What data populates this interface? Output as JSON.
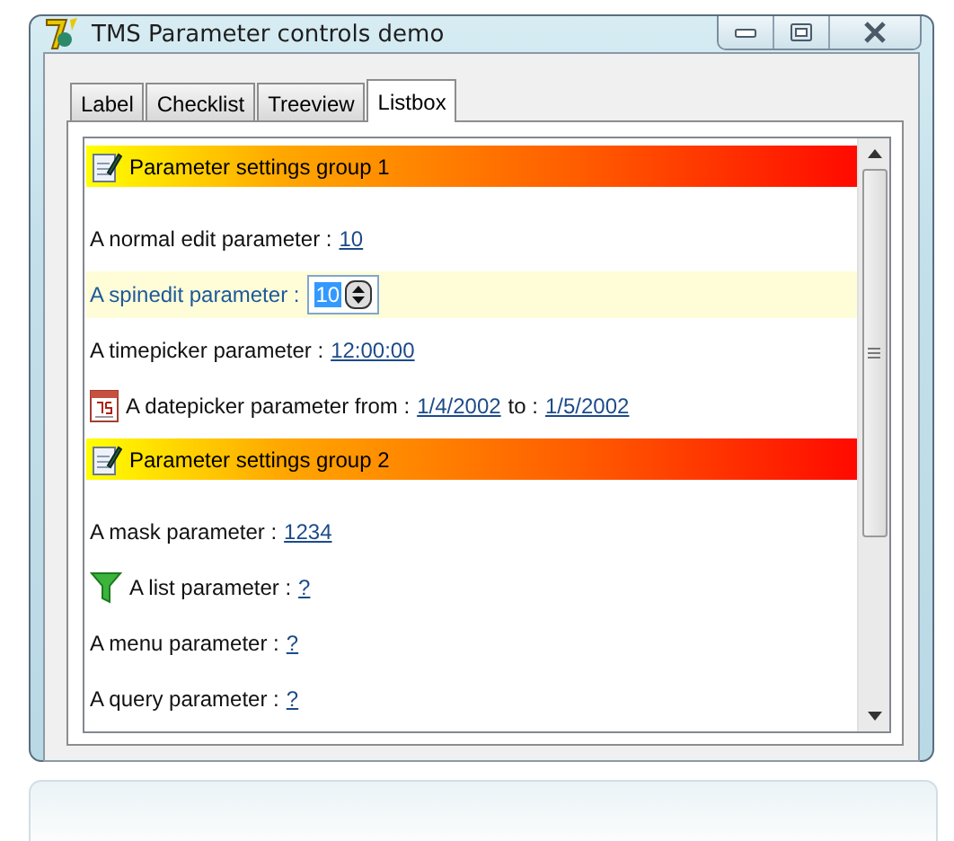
{
  "window": {
    "title": "TMS Parameter controls demo"
  },
  "tabs": [
    {
      "label": "Label",
      "selected": false
    },
    {
      "label": "Checklist",
      "selected": false
    },
    {
      "label": "Treeview",
      "selected": false
    },
    {
      "label": "Listbox",
      "selected": true
    }
  ],
  "listbox": {
    "rows": [
      {
        "kind": "header",
        "label": "Parameter settings group 1",
        "selected": false
      },
      {
        "kind": "edit",
        "label": "A normal edit parameter :",
        "value": "10",
        "selected": false
      },
      {
        "kind": "spin",
        "label": "A spinedit parameter :",
        "value": "10",
        "selected": true
      },
      {
        "kind": "edit",
        "label": "A timepicker parameter :",
        "value": "12:00:00",
        "selected": false
      },
      {
        "kind": "date",
        "label": "A datepicker parameter from :",
        "value": "1/4/2002",
        "to_label": "to :",
        "value2": "1/5/2002",
        "selected": false
      },
      {
        "kind": "header",
        "label": "Parameter settings group 2",
        "selected": false
      },
      {
        "kind": "edit",
        "label": "A mask parameter :",
        "value": "1234",
        "selected": false
      },
      {
        "kind": "list",
        "label": "A list parameter :",
        "value": "?",
        "selected": false
      },
      {
        "kind": "edit",
        "label": "A menu parameter :",
        "value": "?",
        "selected": false
      },
      {
        "kind": "edit",
        "label": "A query parameter :",
        "value": "?",
        "selected": false
      }
    ]
  }
}
